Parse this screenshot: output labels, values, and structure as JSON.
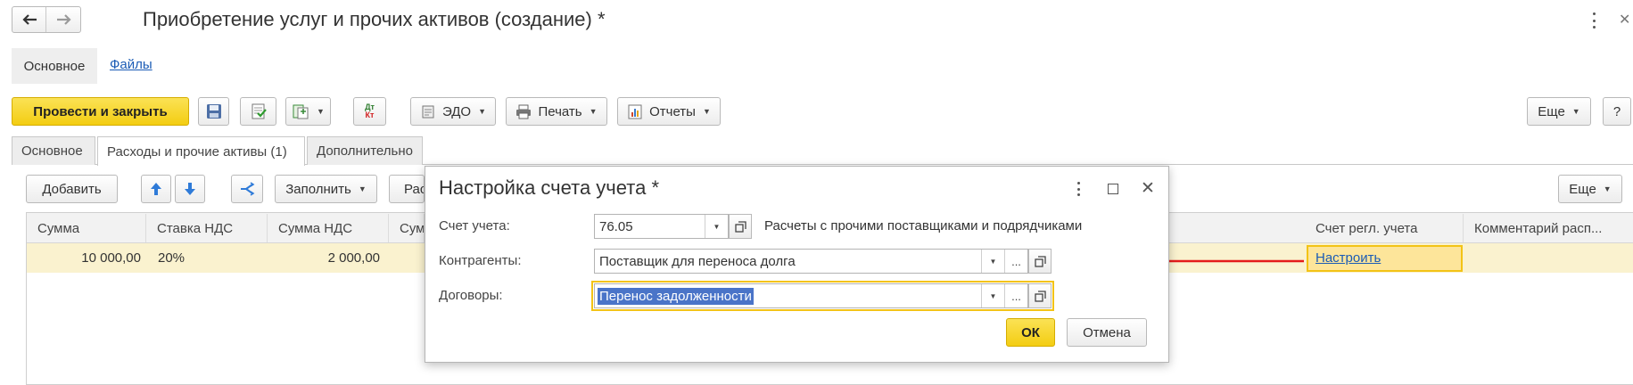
{
  "window": {
    "title": "Приобретение услуг и прочих активов (создание) *"
  },
  "nav_tabs": [
    {
      "label": "Основное"
    },
    {
      "label": "Файлы"
    }
  ],
  "toolbar": {
    "post_close_label": "Провести и закрыть",
    "edo_label": "ЭДО",
    "print_label": "Печать",
    "reports_label": "Отчеты",
    "more_label": "Еще",
    "help_label": "?",
    "dt_kt_top": "Дт",
    "dt_kt_bottom": "Кт"
  },
  "doc_tabs": [
    {
      "label": "Основное"
    },
    {
      "label": "Расходы и прочие активы (1)"
    },
    {
      "label": "Дополнительно"
    }
  ],
  "table_toolbar": {
    "add_label": "Добавить",
    "fill_label": "Заполнить",
    "partial_label": "Рас",
    "more_label": "Еще"
  },
  "table": {
    "headers": [
      "Сумма",
      "Ставка НДС",
      "Сумма НДС",
      "Сум",
      "Счет регл. учета",
      "Комментарий расп..."
    ],
    "rows": [
      {
        "sum": "10 000,00",
        "vat_rate": "20%",
        "vat_sum": "2 000,00",
        "account_link": "Настроить"
      }
    ]
  },
  "dialog": {
    "title": "Настройка счета учета *",
    "account_label": "Счет учета:",
    "account_value": "76.05",
    "account_description": "Расчеты с прочими поставщиками и подрядчиками",
    "contractor_label": "Контрагенты:",
    "contractor_value": "Поставщик для переноса долга",
    "contract_label": "Договоры:",
    "contract_value": "Перенос задолженности",
    "ok_label": "ОК",
    "cancel_label": "Отмена",
    "ellipsis": "..."
  },
  "colors": {
    "accent_yellow": "#f7d32f",
    "link_blue": "#1a5bb5",
    "row_highlight": "#faf2cf",
    "arrow_red": "#e41b1b",
    "selection_blue": "#4a74c8"
  }
}
